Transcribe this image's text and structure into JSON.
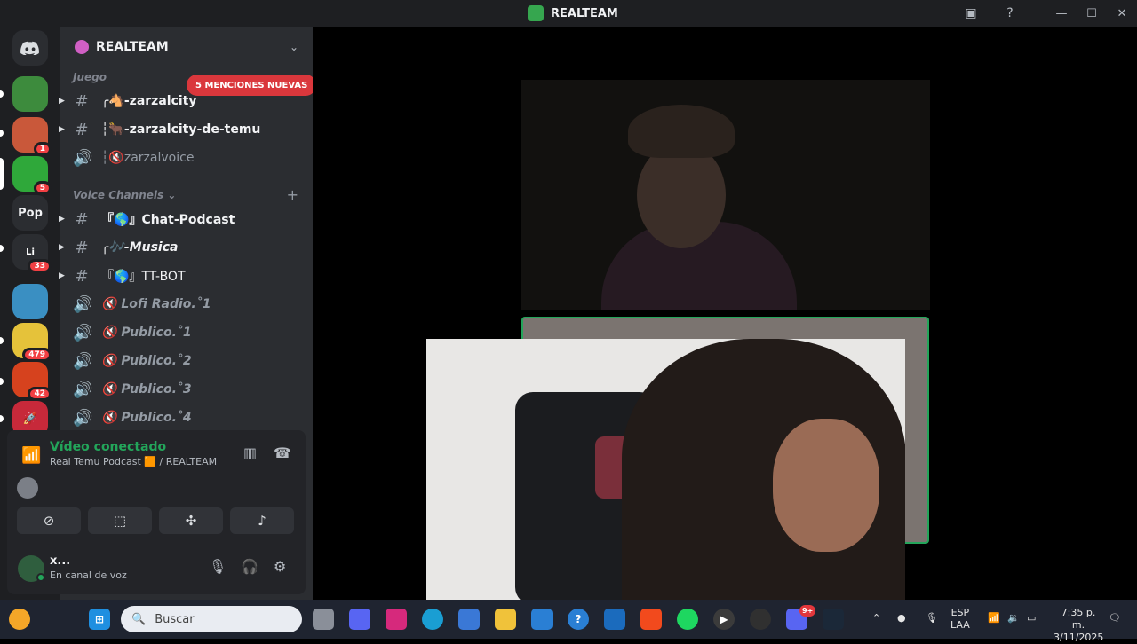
{
  "window": {
    "title": "REALTEAM"
  },
  "guilds": [
    {
      "badge": ""
    },
    {
      "badge": "1"
    },
    {
      "badge": "5"
    },
    {
      "label": "Pop"
    },
    {
      "label": "Li",
      "badge": "33"
    },
    {
      "badge": ""
    },
    {
      "badge": "479"
    },
    {
      "badge": "42"
    },
    {
      "badge": ""
    }
  ],
  "server": {
    "name": "REALTEAM",
    "mentions_pill": "5 MENCIONES NUEVAS",
    "category1": "Juego",
    "category2": "Voice Channels",
    "channels": [
      {
        "name": "-zarzalcity",
        "prefix": "╭🐴"
      },
      {
        "name": "-zarzalcity-de-temu",
        "prefix": "┆🐂"
      },
      {
        "name": "zarzalvoice",
        "prefix": "┆🔇"
      },
      {
        "name": "Chat-Podcast",
        "prefix": "『🌎』"
      },
      {
        "name": "-Musica",
        "prefix": "╭🎶"
      },
      {
        "name": "TT-BOT",
        "prefix": "『🌎』"
      },
      {
        "name": "Lofi Radio.˚1",
        "prefix": "🔇"
      },
      {
        "name": "Publico.˚1",
        "prefix": "🔇"
      },
      {
        "name": "Publico.˚2",
        "prefix": "🔇"
      },
      {
        "name": "Publico.˚3",
        "prefix": "🔇"
      },
      {
        "name": "Publico.˚4",
        "prefix": "🔇"
      }
    ]
  },
  "voice": {
    "status": "Vídeo conectado",
    "channel": "Real Temu Podcast 🟧 / REALTEAM"
  },
  "user": {
    "name": "x...",
    "status": "En canal de voz"
  },
  "taskbar": {
    "search_placeholder": "Buscar",
    "discord_badge": "9+",
    "lang1": "ESP",
    "lang2": "LAA",
    "time": "7:35 p. m.",
    "date": "3/11/2025"
  }
}
